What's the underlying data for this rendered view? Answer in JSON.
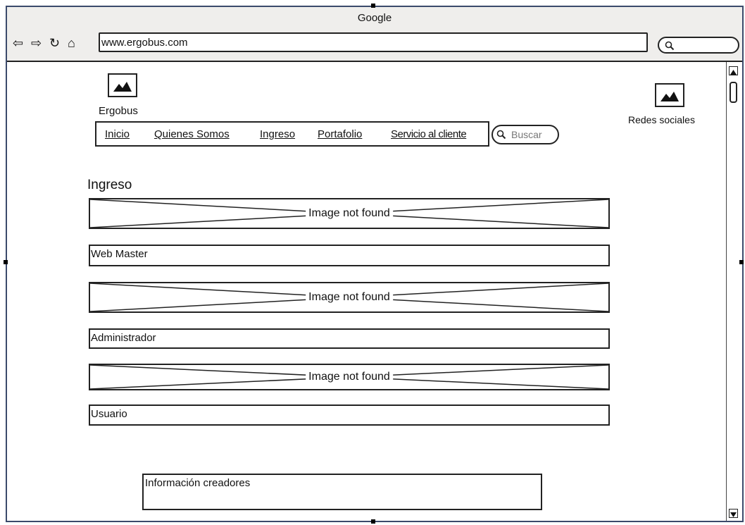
{
  "browser": {
    "title": "Google",
    "url": "www.ergobus.com",
    "nav_icons": [
      "back-arrow-icon",
      "forward-arrow-icon",
      "refresh-icon",
      "home-icon"
    ]
  },
  "header": {
    "logo_label": "Ergobus",
    "social_label": "Redes sociales"
  },
  "nav": {
    "items": [
      {
        "label": "Inicio"
      },
      {
        "label": "Quienes Somos"
      },
      {
        "label": "Ingreso"
      },
      {
        "label": "Portafolio"
      },
      {
        "label": "Servicio al cliente"
      }
    ],
    "search_placeholder": "Buscar"
  },
  "main": {
    "title": "Ingreso",
    "image_placeholder_text": "Image not found",
    "fields": [
      {
        "value": "Web Master"
      },
      {
        "value": "Administrador"
      },
      {
        "value": "Usuario"
      }
    ]
  },
  "footer": {
    "info": "Información creadores"
  }
}
